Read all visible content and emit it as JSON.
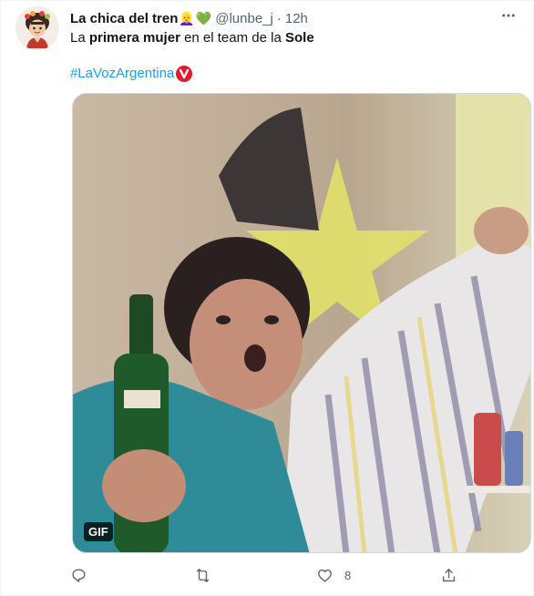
{
  "tweet": {
    "display_name": "La chica del tren",
    "name_emojis": [
      "👱‍♀️",
      "💚"
    ],
    "handle": "@lunbe_j",
    "separator": "·",
    "timestamp": "12h",
    "more_icon": "more-dots-icon",
    "text_parts": [
      {
        "text": "La ",
        "bold": false
      },
      {
        "text": "primera mujer",
        "bold": true
      },
      {
        "text": " en el team de la ",
        "bold": false
      },
      {
        "text": "Sole",
        "bold": true
      }
    ],
    "hashtag": "#LaVozArgentina",
    "hashflag_icon": "la-voz-hashflag-icon",
    "media": {
      "type": "gif",
      "badge": "GIF"
    },
    "actions": {
      "reply_icon": "reply-icon",
      "retweet_icon": "retweet-icon",
      "like_icon": "heart-icon",
      "like_count": "8",
      "share_icon": "share-icon"
    }
  },
  "colors": {
    "accent": "#1d9bf0",
    "secondary_text": "#536471",
    "hashflag_red": "#e0192e"
  }
}
